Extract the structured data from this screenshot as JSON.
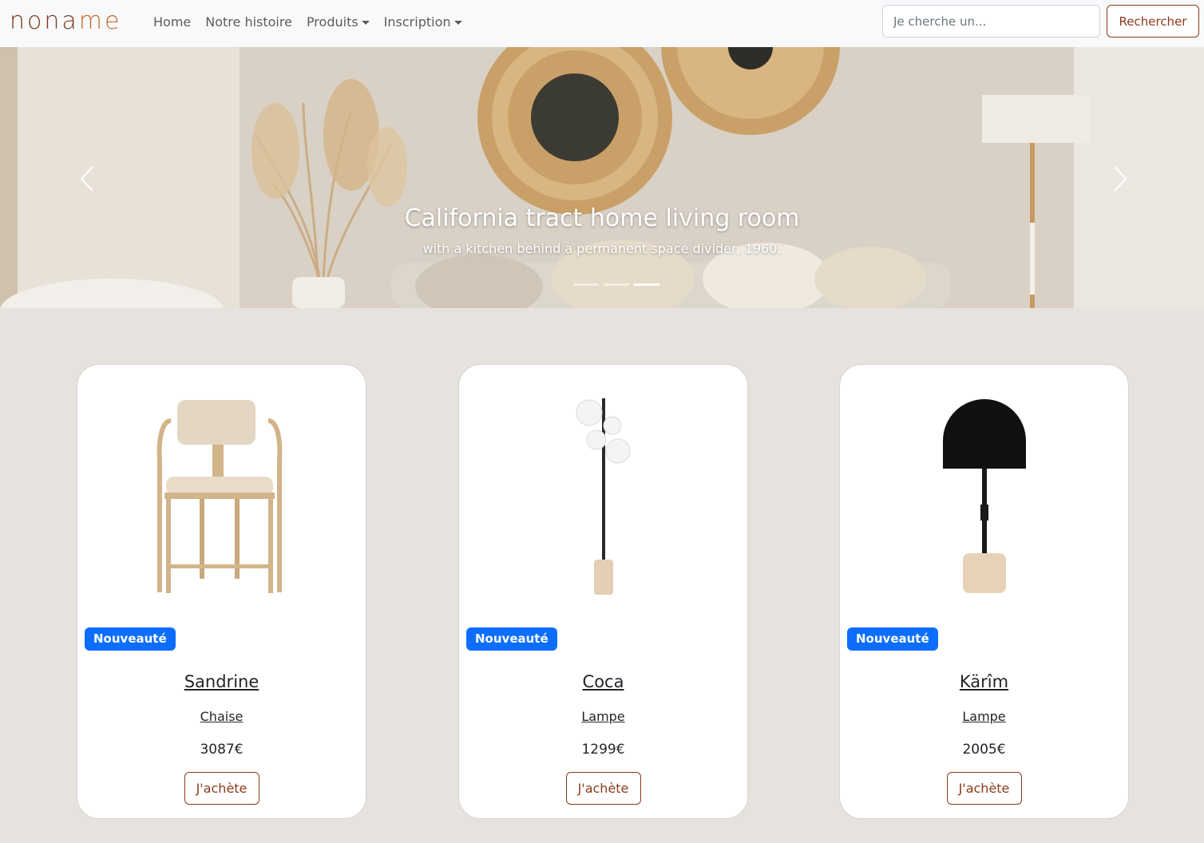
{
  "brand": {
    "part1": "nona",
    "part2": "me",
    "color_dark": "#7a3a1b",
    "color_accent": "#c8672f"
  },
  "nav": {
    "home": "Home",
    "history": "Notre histoire",
    "products": "Produits",
    "signup": "Inscription"
  },
  "search": {
    "placeholder": "Je cherche un...",
    "button_label": "Rechercher"
  },
  "hero": {
    "title": "California tract home living room",
    "subtitle": "with a kitchen behind a permanent space divider, 1960.",
    "slide_count": 3,
    "active_slide": 2
  },
  "products": [
    {
      "badge": "Nouveauté",
      "name": "Sandrine",
      "category": "Chaise",
      "price": "3087€",
      "button": "J'achète",
      "icon": "chair-image"
    },
    {
      "badge": "Nouveauté",
      "name": "Coca",
      "category": "Lampe",
      "price": "1299€",
      "button": "J'achète",
      "icon": "floor-lamp-image"
    },
    {
      "badge": "Nouveauté",
      "name": "Kärîm",
      "category": "Lampe",
      "price": "2005€",
      "button": "J'achète",
      "icon": "table-lamp-image"
    }
  ],
  "colors": {
    "accent_brown": "#8b3a1a",
    "badge_blue": "#0d6efd",
    "page_background": "#e6e3de"
  }
}
